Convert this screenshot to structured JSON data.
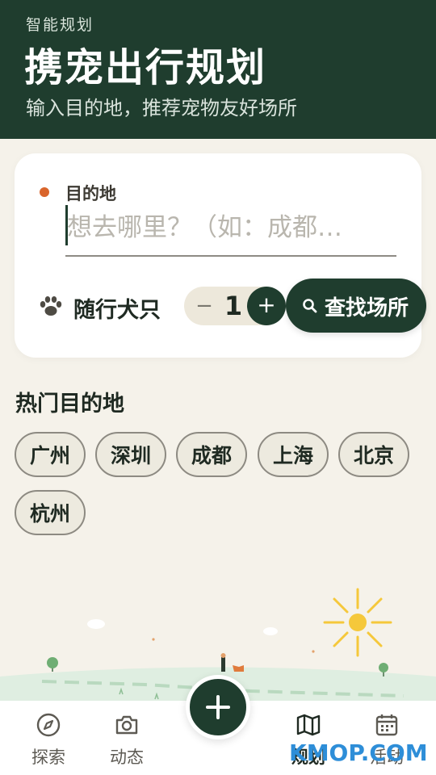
{
  "header": {
    "kicker": "智能规划",
    "title": "携宠出行规划",
    "subtitle": "输入目的地，推荐宠物友好场所"
  },
  "form": {
    "destination_label": "目的地",
    "destination_placeholder": "想去哪里？（如：成都…",
    "destination_value": "",
    "pets_label": "随行犬只",
    "pets_icon": "paw-icon",
    "pet_count": "1",
    "minus_label": "−",
    "plus_label": "+",
    "search_label": "查找场所",
    "search_icon": "search-icon",
    "accent_color": "#1f3d2e",
    "dot_color": "#d9652c"
  },
  "popular": {
    "title": "热门目的地",
    "cities": [
      "广州",
      "深圳",
      "成都",
      "上海",
      "北京",
      "杭州"
    ]
  },
  "fab": {
    "icon": "plus-icon"
  },
  "bottom_nav": [
    {
      "label": "探索",
      "icon": "compass-icon"
    },
    {
      "label": "动态",
      "icon": "camera-icon"
    },
    {
      "label": "规划",
      "icon": "map-icon",
      "active": true
    },
    {
      "label": "活动",
      "icon": "calendar-icon"
    }
  ],
  "watermark": {
    "prefix": "K",
    "suffix": "KMOP.COM"
  }
}
